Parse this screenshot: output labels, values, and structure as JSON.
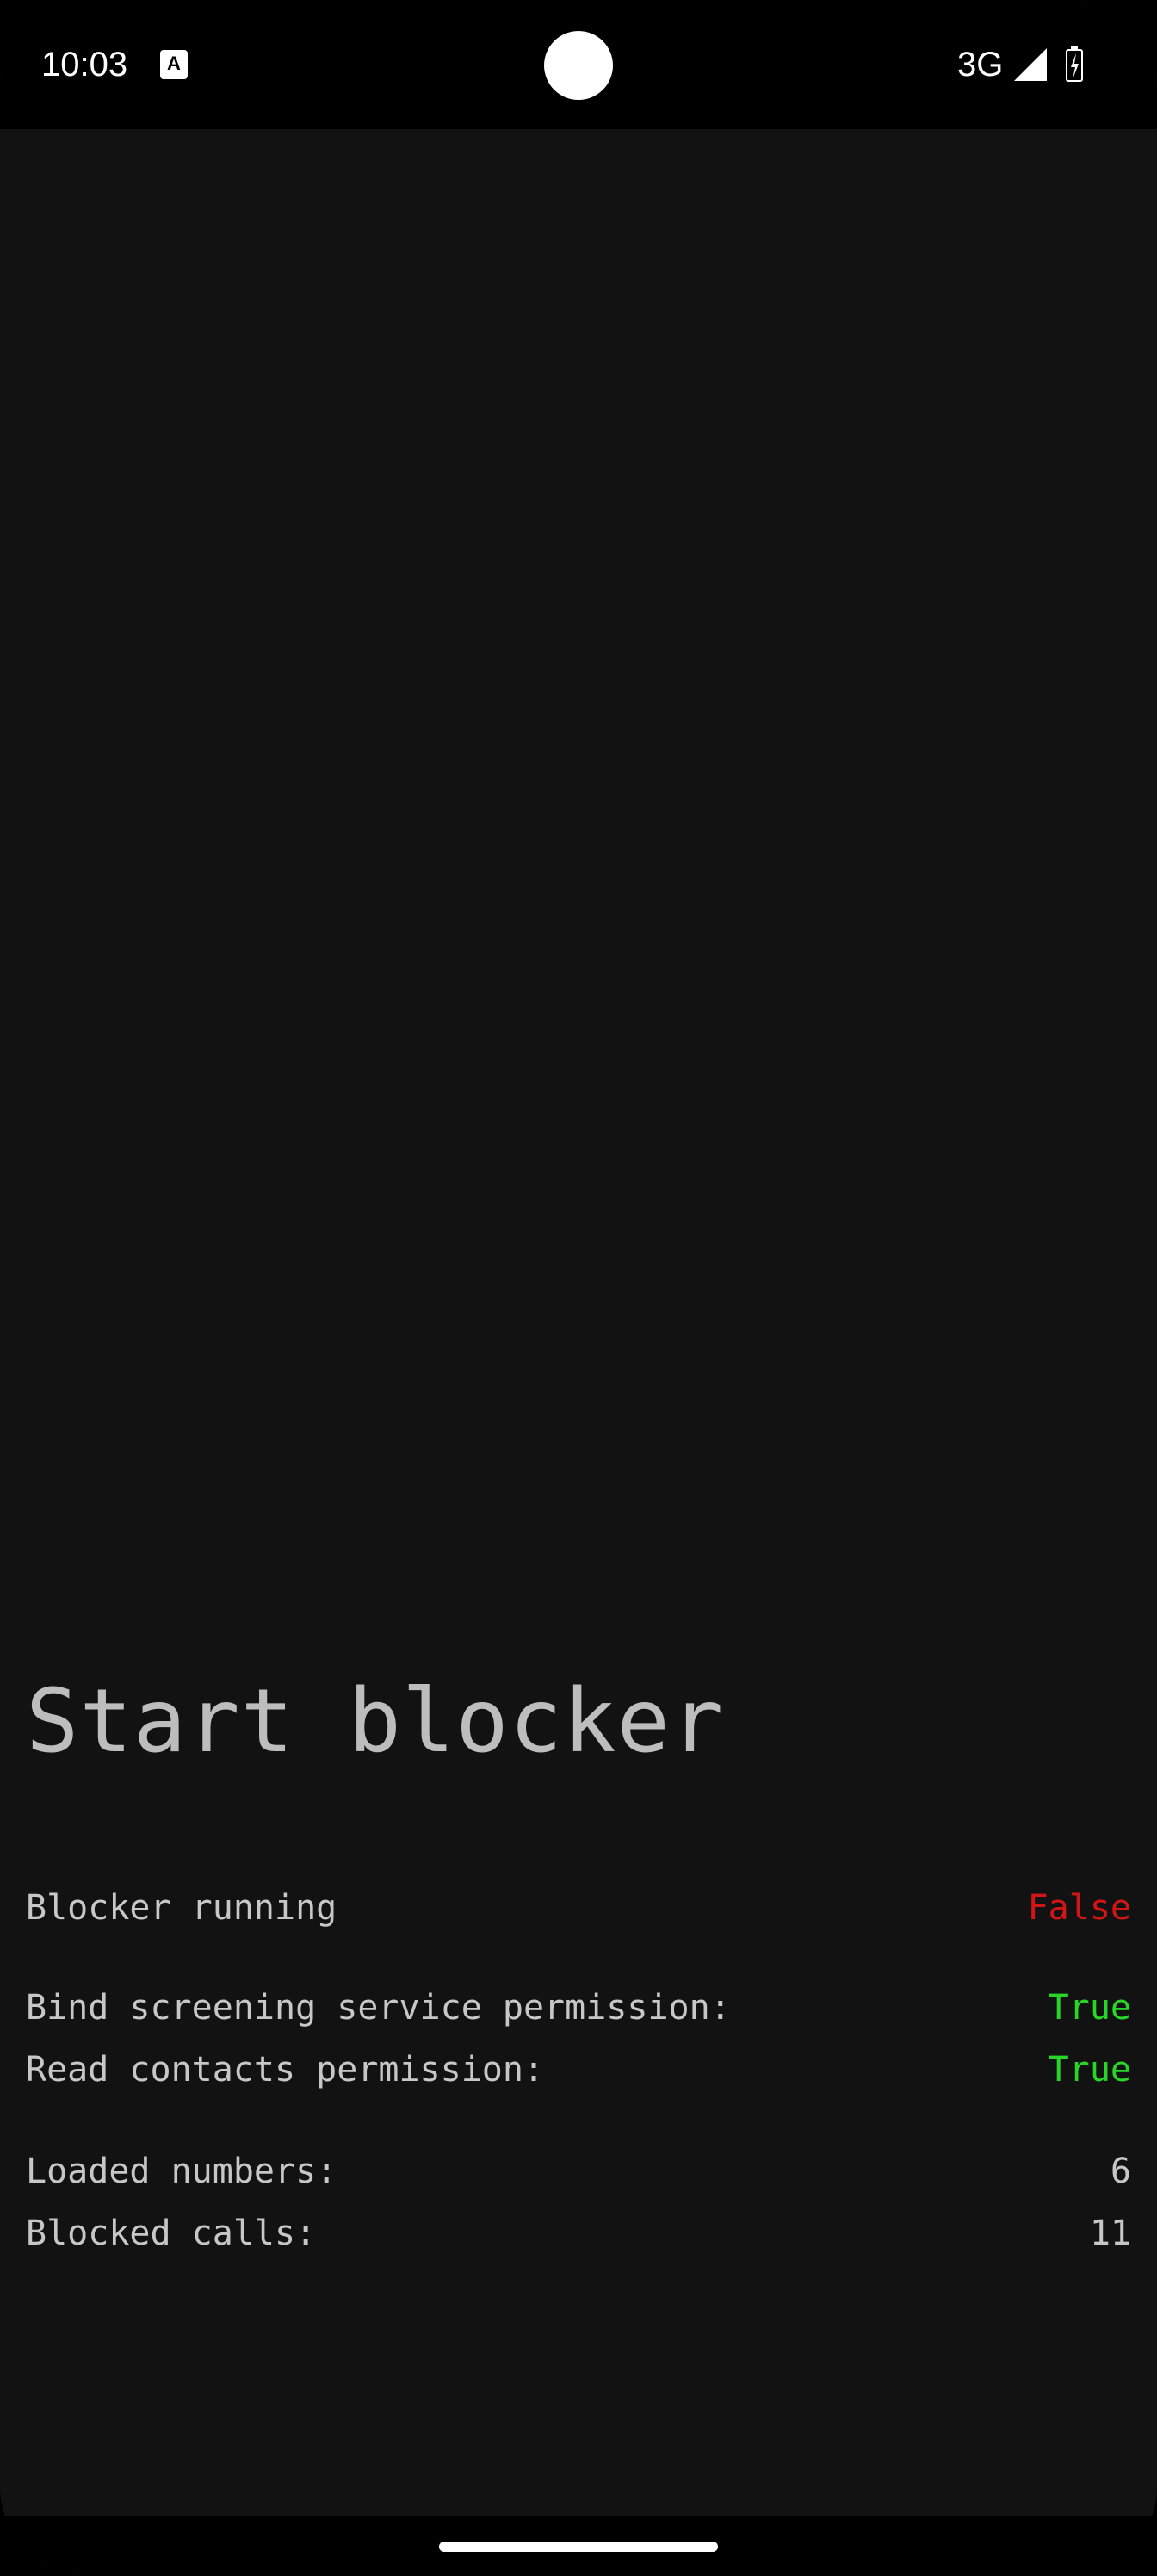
{
  "status_bar": {
    "time": "10:03",
    "notification_icon_letter": "A",
    "network": "3G",
    "icons": [
      "notification-app-icon",
      "signal-icon",
      "battery-icon"
    ]
  },
  "main": {
    "title": "Start blocker",
    "blocker_running": {
      "label": "Blocker running",
      "value": "False"
    },
    "bind_screening": {
      "label": "Bind screening service permission:",
      "value": "True"
    },
    "read_contacts": {
      "label": "Read contacts permission:",
      "value": "True"
    },
    "loaded_numbers": {
      "label": "Loaded numbers:",
      "value": "6"
    },
    "blocked_calls": {
      "label": "Blocked calls:",
      "value": "11"
    }
  },
  "colors": {
    "background": "#121212",
    "text": "#c7c7c7",
    "false_value": "#d31515",
    "true_value": "#28d628"
  }
}
